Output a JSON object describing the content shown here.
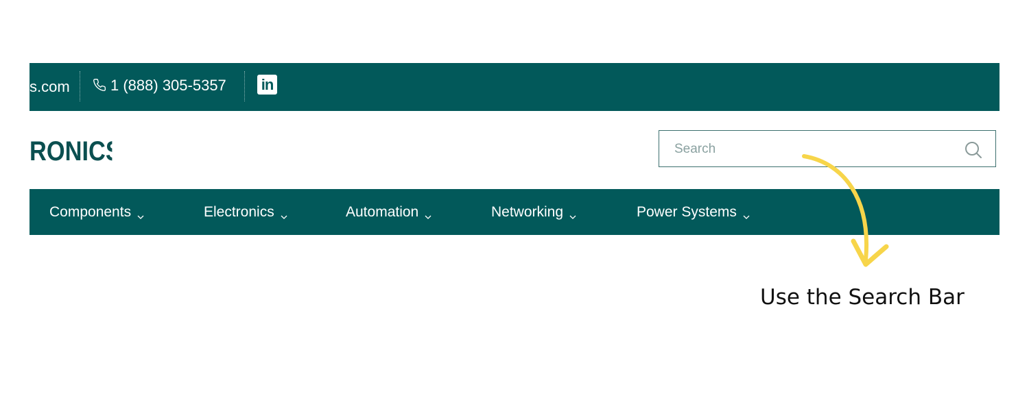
{
  "topbar": {
    "email_fragment": "s.com",
    "phone": "1 (888) 305-5357",
    "linkedin_label": "in",
    "phone_icon": "phone-icon",
    "linkedin_icon": "linkedin-icon"
  },
  "logo": {
    "text": "RONICS"
  },
  "search": {
    "placeholder": "Search",
    "icon": "search-icon"
  },
  "nav": {
    "items": [
      {
        "label": "Components"
      },
      {
        "label": "Electronics"
      },
      {
        "label": "Automation"
      },
      {
        "label": "Networking"
      },
      {
        "label": "Power Systems"
      }
    ]
  },
  "annotation": {
    "text": "Use the Search Bar",
    "arrow_color": "#f7d54a"
  },
  "colors": {
    "brand": "#02595a",
    "logo": "#0b4f50",
    "background": "#ffffff"
  }
}
